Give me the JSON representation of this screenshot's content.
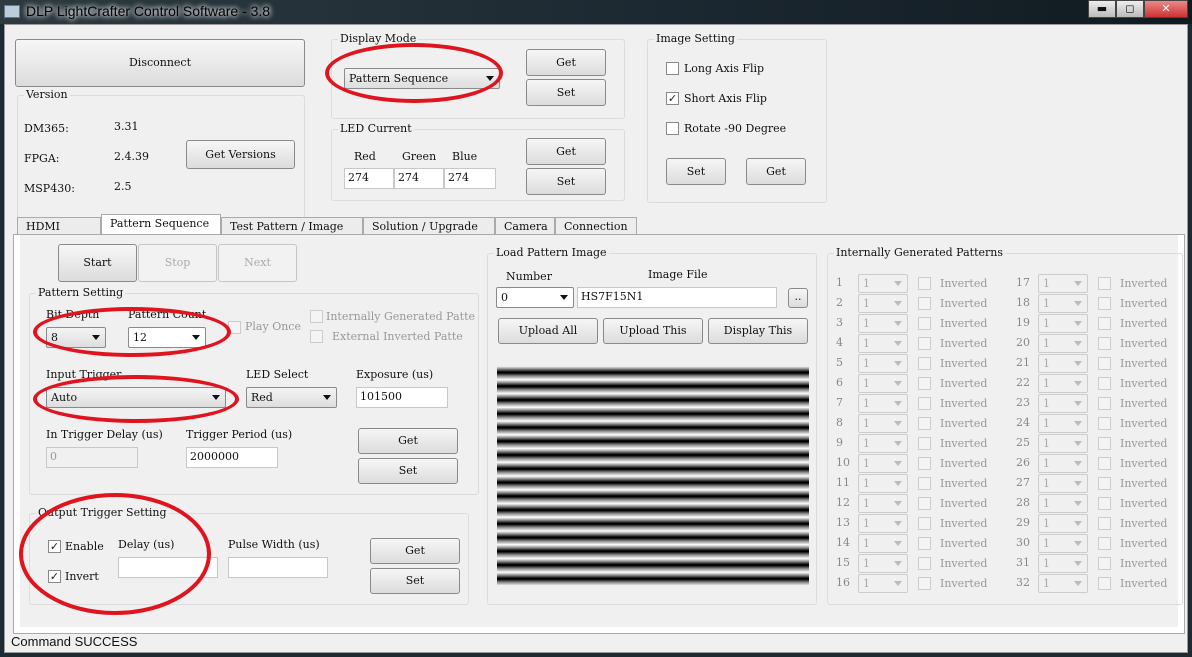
{
  "window": {
    "title": "DLP LightCrafter Control Software - 3.8",
    "minimize": "▬",
    "maximize": "◻",
    "close": "✕"
  },
  "top": {
    "disconnect": "Disconnect",
    "version": {
      "label": "Version",
      "dm365_label": "DM365:",
      "dm365": "3.31",
      "fpga_label": "FPGA:",
      "fpga": "2.4.39",
      "msp430_label": "MSP430:",
      "msp430": "2.5",
      "get_versions": "Get Versions"
    },
    "display_mode": {
      "label": "Display Mode",
      "value": "Pattern Sequence",
      "get": "Get",
      "set": "Set"
    },
    "led_current": {
      "label": "LED Current",
      "red_label": "Red",
      "green_label": "Green",
      "blue_label": "Blue",
      "red": "274",
      "green": "274",
      "blue": "274",
      "get": "Get",
      "set": "Set"
    },
    "image_setting": {
      "label": "Image Setting",
      "long_axis": "Long Axis Flip",
      "long_axis_checked": false,
      "short_axis": "Short Axis Flip",
      "short_axis_checked": true,
      "rotate": "Rotate -90 Degree",
      "rotate_checked": false,
      "set": "Set",
      "get": "Get"
    }
  },
  "tabs": [
    {
      "label": "HDMI Video"
    },
    {
      "label": "Pattern Sequence",
      "selected": true
    },
    {
      "label": "Test Pattern / Image"
    },
    {
      "label": "Solution / Upgrade"
    },
    {
      "label": "Camera"
    },
    {
      "label": "Connection"
    }
  ],
  "pattern": {
    "start": "Start",
    "stop": "Stop",
    "next": "Next",
    "setting_label": "Pattern Setting",
    "bit_depth_label": "Bit Depth",
    "bit_depth": "8",
    "pattern_count_label": "Pattern Count",
    "pattern_count": "12",
    "play_once": "Play Once",
    "internally_generated": "Internally Generated Patte",
    "external_inverted": "External Inverted Patte",
    "input_trigger_label": "Input Trigger",
    "input_trigger": "Auto",
    "led_select_label": "LED Select",
    "led_select": "Red",
    "exposure_label": "Exposure (us)",
    "exposure": "101500",
    "in_trigger_delay_label": "In Trigger Delay (us)",
    "in_trigger_delay": "0",
    "trigger_period_label": "Trigger Period (us)",
    "trigger_period": "2000000",
    "get": "Get",
    "set": "Set"
  },
  "output_trigger": {
    "label": "Output Trigger Setting",
    "enable": "Enable",
    "enable_checked": true,
    "invert": "Invert",
    "invert_checked": true,
    "delay_label": "Delay (us)",
    "delay": "",
    "pulse_width_label": "Pulse Width (us)",
    "pulse_width": "",
    "get": "Get",
    "set": "Set"
  },
  "load_image": {
    "label": "Load Pattern Image",
    "number_label": "Number",
    "number": "0",
    "file_label": "Image File",
    "file": "HS7F15N1",
    "browse": "..",
    "upload_all": "Upload All",
    "upload_this": "Upload This",
    "display_this": "Display This"
  },
  "internal": {
    "label": "Internally Generated Patterns",
    "value": "1",
    "inverted": "Inverted",
    "count": 32
  },
  "status": "Command SUCCESS",
  "colors": {
    "annotation": "#e0141e"
  }
}
